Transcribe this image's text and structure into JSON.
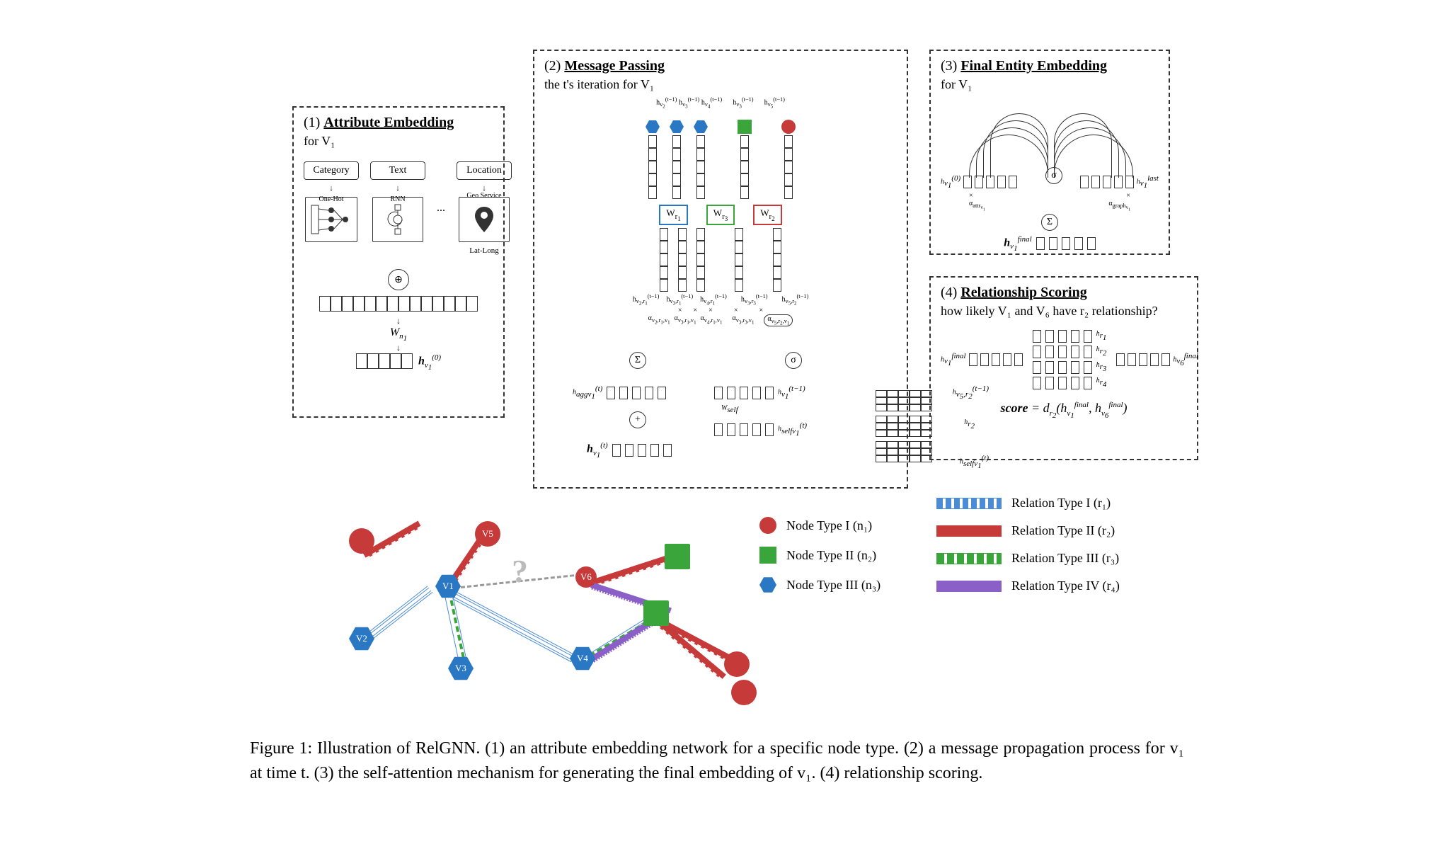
{
  "panel1": {
    "num": "(1)",
    "title": "Attribute Embedding",
    "sub": "for V₁",
    "features": [
      "Category",
      "Text",
      "Location"
    ],
    "encoders": [
      "One-Hot",
      "RNN",
      "Geo Service"
    ],
    "latlong": "Lat-Long",
    "ellipsis": "...",
    "concat": "⊕",
    "wn": "W_{n_1}",
    "out": "h_{v_1}^{(0)}"
  },
  "panel2": {
    "num": "(2)",
    "title": "Message Passing",
    "sub": "the t's iteration for V₁",
    "top_labels": [
      "h_{v_2}^{(t-1)}",
      "h_{v_3}^{(t-1)}",
      "h_{v_4}^{(t-1)}",
      "h_{v_3}^{(t-1)}",
      "h_{v_5}^{(t-1)}"
    ],
    "W": [
      "W_{r_1}",
      "W_{r_3}",
      "W_{r_2}"
    ],
    "proj_labels": [
      "h_{v_2,r_1}^{(t-1)}",
      "h_{v_3,r_1}^{(t-1)}",
      "h_{v_4,r_1}^{(t-1)}",
      "h_{v_3,r_3}^{(t-1)}",
      "h_{v_5,r_2}^{(t-1)}"
    ],
    "alpha": [
      "α_{v_2,r_1,v_1}",
      "α_{v_3,r_1,v_1}",
      "α_{v_4,r_1,v_1}",
      "α_{v_3,r_3,v_1}",
      "α_{v_5,r_2,v_1}"
    ],
    "sum": "Σ",
    "sigma": "σ",
    "plus": "+",
    "mult": "×",
    "hagg": "h_{aggv_1}^{(t)}",
    "hv1t": "h_{v_1}^{(t)}",
    "Wself": "W_{self}",
    "hv1prev": "h_{v_1}^{(t-1)}",
    "hself": "h_{selfv_1}^{(t)}",
    "right_top": "h_{v_5,r_2}^{(t-1)}",
    "right_mid": "h_{r_2}",
    "right_bot": "h_{selfv_1}^{(t)}"
  },
  "panel3": {
    "num": "(3)",
    "title": "Final Entity Embedding",
    "sub": "for V₁",
    "left": "h_{v_1}^{(0)}",
    "right": "h_{v_1}^{last}",
    "a_attr": "α_{attr_{v_1}}",
    "a_graph": "α_{graph_{v_1}}",
    "out": "h_{v_1}^{final}",
    "sigma": "σ",
    "sum": "Σ",
    "mult": "×"
  },
  "panel4": {
    "num": "(4)",
    "title": "Relationship Scoring",
    "sub": "how likely V₁ and V₆ have r₂ relationship?",
    "left": "h_{v_1}^{final}",
    "right": "h_{v_6}^{final}",
    "hr": [
      "h_{r_1}",
      "h_{r_2}",
      "h_{r_3}",
      "h_{r_4}"
    ],
    "score": "score = d_{r_2}(h_{v_1}^{final}, h_{v_6}^{final})"
  },
  "graph_nodes": [
    "V1",
    "V2",
    "V3",
    "V4",
    "V5",
    "V6"
  ],
  "qmark": "?",
  "legend": {
    "nodes": [
      "Node Type I (n₁)",
      "Node Type II (n₂)",
      "Node Type III (n₃)"
    ],
    "rels": [
      "Relation Type I (r₁)",
      "Relation Type II (r₂)",
      "Relation Type III (r₃)",
      "Relation Type IV (r₄)"
    ]
  },
  "caption": "Figure 1: Illustration of RelGNN. (1) an attribute embedding network for a specific node type. (2) a message propagation process for v₁ at time t. (3) the self-attention mechanism for generating the final embedding of v₁. (4) relationship scoring."
}
